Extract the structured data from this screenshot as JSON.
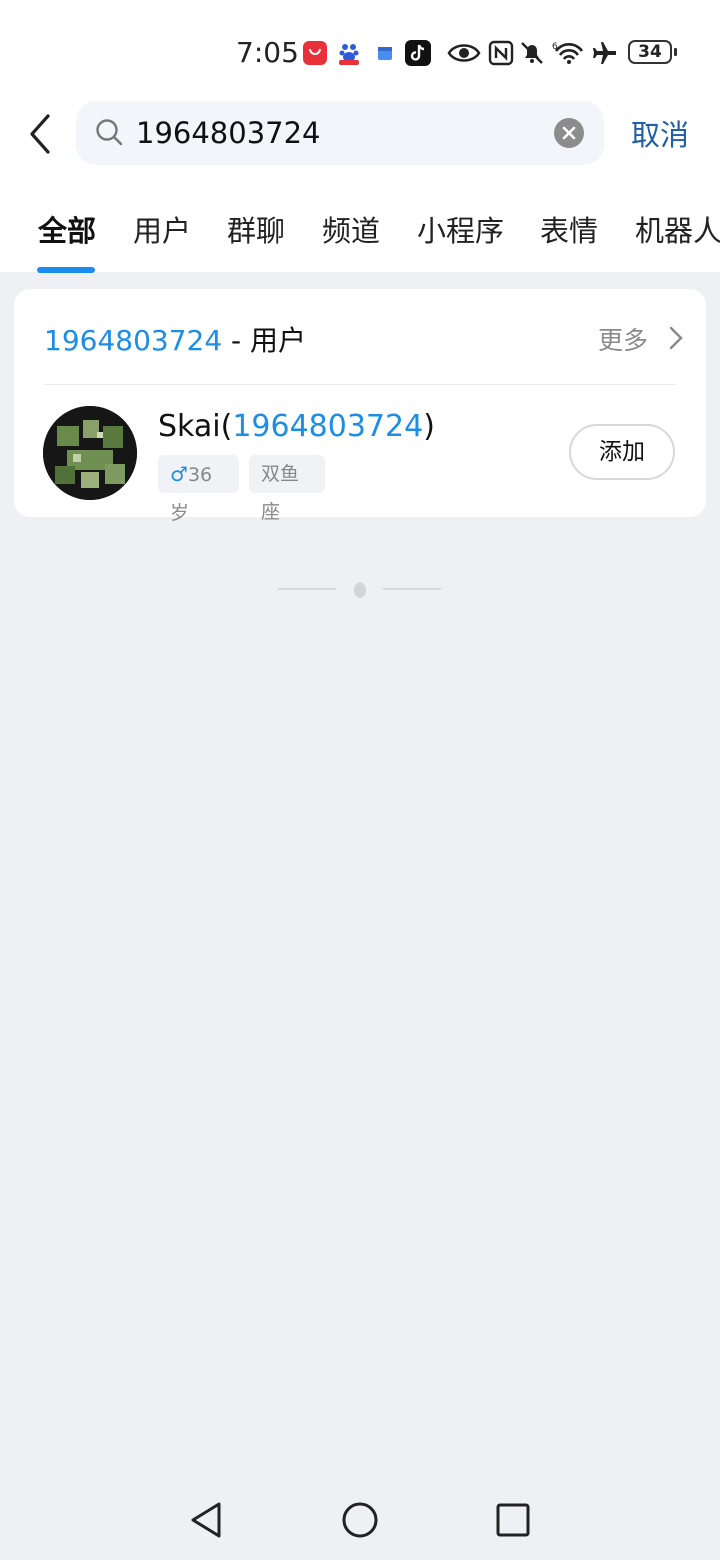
{
  "status_bar": {
    "time": "7:05",
    "battery": "34",
    "icons": [
      "huawei-appgallery-icon",
      "baidu-icon",
      "calendar-icon",
      "tiktok-icon",
      "eye-icon",
      "nfc-icon",
      "mute-bell-icon",
      "wifi-icon",
      "airplane-icon"
    ]
  },
  "search": {
    "query": "1964803724",
    "cancel_label": "取消"
  },
  "tabs": [
    {
      "label": "全部",
      "active": true
    },
    {
      "label": "用户",
      "active": false
    },
    {
      "label": "群聊",
      "active": false
    },
    {
      "label": "频道",
      "active": false
    },
    {
      "label": "小程序",
      "active": false
    },
    {
      "label": "表情",
      "active": false
    },
    {
      "label": "机器人",
      "active": false
    }
  ],
  "result_section": {
    "query_number": "1964803724",
    "category_suffix": " - 用户",
    "more_label": "更多",
    "user": {
      "name_prefix": "Skai(",
      "id": "1964803724",
      "name_suffix": ")",
      "gender_symbol": "♂",
      "age": "36岁",
      "zodiac": "双鱼座",
      "add_label": "添加"
    }
  },
  "colors": {
    "accent_blue": "#1c8ee6",
    "cancel_blue": "#1f5fa8",
    "background": "#eff0f3"
  }
}
